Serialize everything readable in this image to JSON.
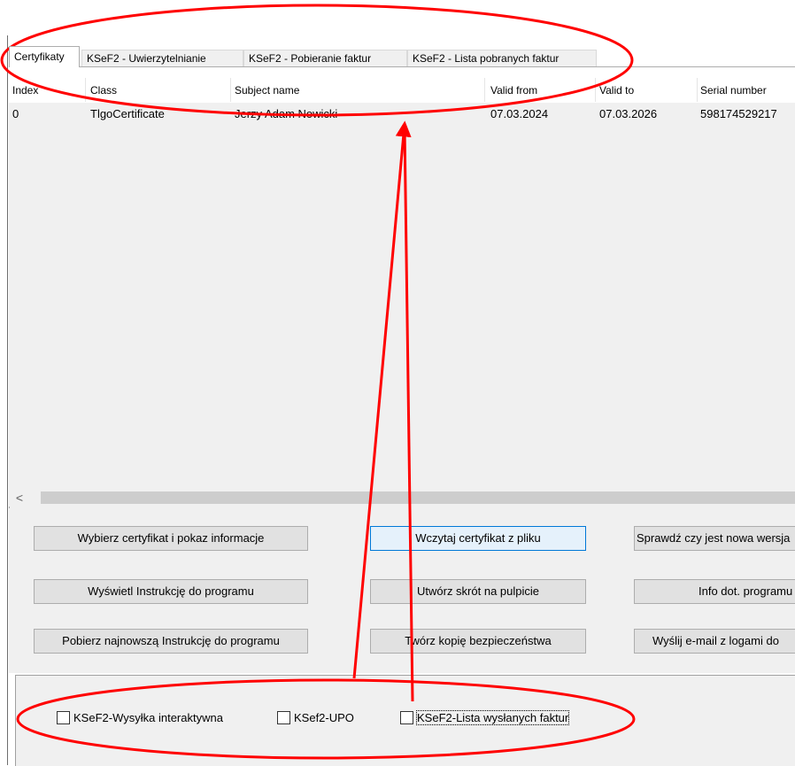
{
  "tabs": [
    {
      "label": "Certyfikaty",
      "active": true
    },
    {
      "label": "KSeF2 - Uwierzytelnianie",
      "active": false
    },
    {
      "label": "KSeF2 - Pobieranie faktur",
      "active": false
    },
    {
      "label": "KSeF2 - Lista pobranych faktur",
      "active": false
    }
  ],
  "table": {
    "columns": [
      "Index",
      "Class",
      "Subject name",
      "Valid from",
      "Valid to",
      "Serial number"
    ],
    "rows": [
      [
        "0",
        "TlgoCertificate",
        "Jerzy Adam Nowicki",
        "07.03.2024",
        "07.03.2026",
        "598174529217"
      ]
    ]
  },
  "scrollbar": {
    "left_arrow": "<"
  },
  "buttons": {
    "select_cert": "Wybierz certyfikat i pokaz informacje",
    "load_cert": "Wczytaj certyfikat z pliku",
    "check_version": "Sprawdź czy jest nowa  wersja",
    "show_manual": "Wyświetl Instrukcję do programu",
    "create_shortcut": "Utwórz skrót na pulpicie",
    "program_info": "Info dot.  programu",
    "download_manual": "Pobierz najnowszą Instrukcję do programu",
    "backup": "Twórz kopię bezpieczeństwa",
    "send_logs": "Wyślij e-mail z logami do"
  },
  "checkboxes": [
    {
      "label": "KSeF2-Wysyłka interaktywna",
      "checked": false
    },
    {
      "label": "KSef2-UPO",
      "checked": false
    },
    {
      "label": "KSeF2-Lista wysłanych faktur",
      "checked": false
    }
  ],
  "annotation": {
    "color": "#ff0000"
  }
}
